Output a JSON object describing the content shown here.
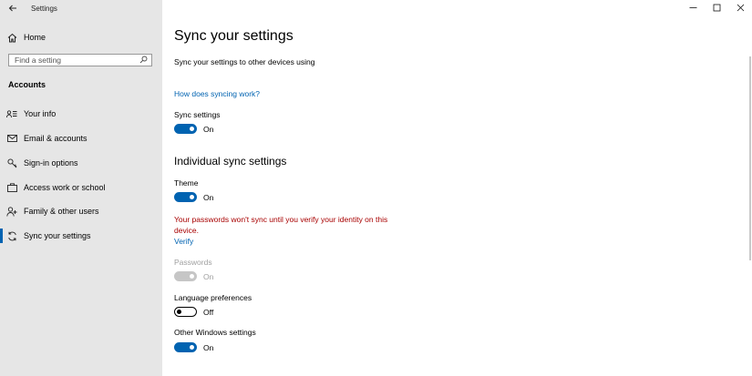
{
  "window": {
    "title": "Settings"
  },
  "sidebar": {
    "home_label": "Home",
    "search_placeholder": "Find a setting",
    "section_title": "Accounts",
    "items": [
      {
        "label": "Your info",
        "icon": "user-info-icon"
      },
      {
        "label": "Email & accounts",
        "icon": "mail-icon"
      },
      {
        "label": "Sign-in options",
        "icon": "key-icon"
      },
      {
        "label": "Access work or school",
        "icon": "briefcase-icon"
      },
      {
        "label": "Family & other users",
        "icon": "person-add-icon"
      },
      {
        "label": "Sync your settings",
        "icon": "sync-icon",
        "selected": true
      }
    ]
  },
  "main": {
    "title": "Sync your settings",
    "subtitle": "Sync your settings to other devices using",
    "help_link": "How does syncing work?",
    "sync_settings": {
      "label": "Sync settings",
      "state": "On"
    },
    "section_title": "Individual sync settings",
    "theme": {
      "label": "Theme",
      "state": "On"
    },
    "warning": "Your passwords won't sync until you verify your identity on this device.",
    "verify_link": "Verify",
    "passwords": {
      "label": "Passwords",
      "state": "On"
    },
    "language": {
      "label": "Language preferences",
      "state": "Off"
    },
    "other": {
      "label": "Other Windows settings",
      "state": "On"
    }
  },
  "colors": {
    "accent": "#0063b1",
    "warning": "#a80000",
    "sidebar_bg": "#e6e6e6"
  }
}
